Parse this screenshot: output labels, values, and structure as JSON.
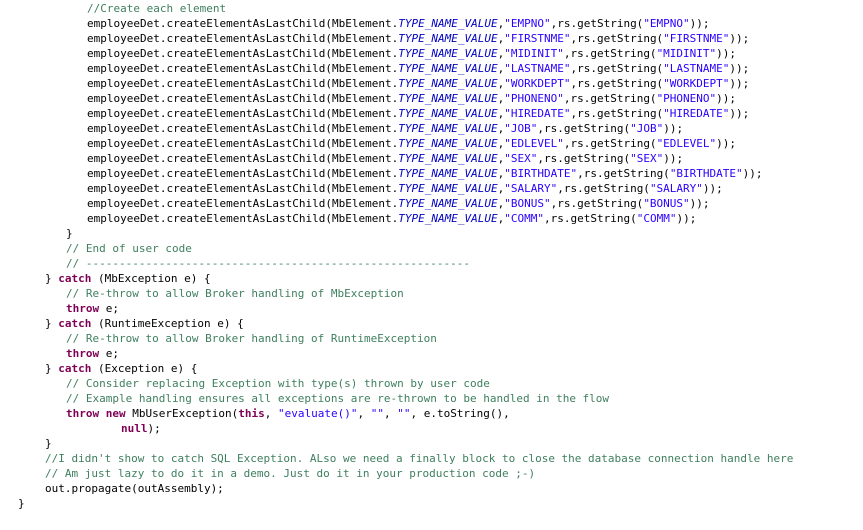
{
  "editor": {
    "lines": [
      {
        "indent": 12,
        "tokens": [
          {
            "t": "comment",
            "v": "//Create each element"
          }
        ]
      },
      {
        "indent": 12,
        "tokens": [
          {
            "t": "plain",
            "v": "employeeDet.createElementAsLastChild(MbElement."
          },
          {
            "t": "field",
            "v": "TYPE_NAME_VALUE"
          },
          {
            "t": "plain",
            "v": ","
          },
          {
            "t": "string",
            "v": "\"EMPNO\""
          },
          {
            "t": "plain",
            "v": ",rs.getString("
          },
          {
            "t": "string",
            "v": "\"EMPNO\""
          },
          {
            "t": "plain",
            "v": "));"
          }
        ]
      },
      {
        "indent": 12,
        "tokens": [
          {
            "t": "plain",
            "v": "employeeDet.createElementAsLastChild(MbElement."
          },
          {
            "t": "field",
            "v": "TYPE_NAME_VALUE"
          },
          {
            "t": "plain",
            "v": ","
          },
          {
            "t": "string",
            "v": "\"FIRSTNME\""
          },
          {
            "t": "plain",
            "v": ",rs.getString("
          },
          {
            "t": "string",
            "v": "\"FIRSTNME\""
          },
          {
            "t": "plain",
            "v": "));"
          }
        ]
      },
      {
        "indent": 12,
        "tokens": [
          {
            "t": "plain",
            "v": "employeeDet.createElementAsLastChild(MbElement."
          },
          {
            "t": "field",
            "v": "TYPE_NAME_VALUE"
          },
          {
            "t": "plain",
            "v": ","
          },
          {
            "t": "string",
            "v": "\"MIDINIT\""
          },
          {
            "t": "plain",
            "v": ",rs.getString("
          },
          {
            "t": "string",
            "v": "\"MIDINIT\""
          },
          {
            "t": "plain",
            "v": "));"
          }
        ]
      },
      {
        "indent": 12,
        "tokens": [
          {
            "t": "plain",
            "v": "employeeDet.createElementAsLastChild(MbElement."
          },
          {
            "t": "field",
            "v": "TYPE_NAME_VALUE"
          },
          {
            "t": "plain",
            "v": ","
          },
          {
            "t": "string",
            "v": "\"LASTNAME\""
          },
          {
            "t": "plain",
            "v": ",rs.getString("
          },
          {
            "t": "string",
            "v": "\"LASTNAME\""
          },
          {
            "t": "plain",
            "v": "));"
          }
        ]
      },
      {
        "indent": 12,
        "tokens": [
          {
            "t": "plain",
            "v": "employeeDet.createElementAsLastChild(MbElement."
          },
          {
            "t": "field",
            "v": "TYPE_NAME_VALUE"
          },
          {
            "t": "plain",
            "v": ","
          },
          {
            "t": "string",
            "v": "\"WORKDEPT\""
          },
          {
            "t": "plain",
            "v": ",rs.getString("
          },
          {
            "t": "string",
            "v": "\"WORKDEPT\""
          },
          {
            "t": "plain",
            "v": "));"
          }
        ]
      },
      {
        "indent": 12,
        "tokens": [
          {
            "t": "plain",
            "v": "employeeDet.createElementAsLastChild(MbElement."
          },
          {
            "t": "field",
            "v": "TYPE_NAME_VALUE"
          },
          {
            "t": "plain",
            "v": ","
          },
          {
            "t": "string",
            "v": "\"PHONENO\""
          },
          {
            "t": "plain",
            "v": ",rs.getString("
          },
          {
            "t": "string",
            "v": "\"PHONENO\""
          },
          {
            "t": "plain",
            "v": "));"
          }
        ]
      },
      {
        "indent": 12,
        "tokens": [
          {
            "t": "plain",
            "v": "employeeDet.createElementAsLastChild(MbElement."
          },
          {
            "t": "field",
            "v": "TYPE_NAME_VALUE"
          },
          {
            "t": "plain",
            "v": ","
          },
          {
            "t": "string",
            "v": "\"HIREDATE\""
          },
          {
            "t": "plain",
            "v": ",rs.getString("
          },
          {
            "t": "string",
            "v": "\"HIREDATE\""
          },
          {
            "t": "plain",
            "v": "));"
          }
        ]
      },
      {
        "indent": 12,
        "tokens": [
          {
            "t": "plain",
            "v": "employeeDet.createElementAsLastChild(MbElement."
          },
          {
            "t": "field",
            "v": "TYPE_NAME_VALUE"
          },
          {
            "t": "plain",
            "v": ","
          },
          {
            "t": "string",
            "v": "\"JOB\""
          },
          {
            "t": "plain",
            "v": ",rs.getString("
          },
          {
            "t": "string",
            "v": "\"JOB\""
          },
          {
            "t": "plain",
            "v": "));"
          }
        ]
      },
      {
        "indent": 12,
        "tokens": [
          {
            "t": "plain",
            "v": "employeeDet.createElementAsLastChild(MbElement."
          },
          {
            "t": "field",
            "v": "TYPE_NAME_VALUE"
          },
          {
            "t": "plain",
            "v": ","
          },
          {
            "t": "string",
            "v": "\"EDLEVEL\""
          },
          {
            "t": "plain",
            "v": ",rs.getString("
          },
          {
            "t": "string",
            "v": "\"EDLEVEL\""
          },
          {
            "t": "plain",
            "v": "));"
          }
        ]
      },
      {
        "indent": 12,
        "tokens": [
          {
            "t": "plain",
            "v": "employeeDet.createElementAsLastChild(MbElement."
          },
          {
            "t": "field",
            "v": "TYPE_NAME_VALUE"
          },
          {
            "t": "plain",
            "v": ","
          },
          {
            "t": "string",
            "v": "\"SEX\""
          },
          {
            "t": "plain",
            "v": ",rs.getString("
          },
          {
            "t": "string",
            "v": "\"SEX\""
          },
          {
            "t": "plain",
            "v": "));"
          }
        ]
      },
      {
        "indent": 12,
        "tokens": [
          {
            "t": "plain",
            "v": "employeeDet.createElementAsLastChild(MbElement."
          },
          {
            "t": "field",
            "v": "TYPE_NAME_VALUE"
          },
          {
            "t": "plain",
            "v": ","
          },
          {
            "t": "string",
            "v": "\"BIRTHDATE\""
          },
          {
            "t": "plain",
            "v": ",rs.getString("
          },
          {
            "t": "string",
            "v": "\"BIRTHDATE\""
          },
          {
            "t": "plain",
            "v": "));"
          }
        ]
      },
      {
        "indent": 12,
        "tokens": [
          {
            "t": "plain",
            "v": "employeeDet.createElementAsLastChild(MbElement."
          },
          {
            "t": "field",
            "v": "TYPE_NAME_VALUE"
          },
          {
            "t": "plain",
            "v": ","
          },
          {
            "t": "string",
            "v": "\"SALARY\""
          },
          {
            "t": "plain",
            "v": ",rs.getString("
          },
          {
            "t": "string",
            "v": "\"SALARY\""
          },
          {
            "t": "plain",
            "v": "));"
          }
        ]
      },
      {
        "indent": 12,
        "tokens": [
          {
            "t": "plain",
            "v": "employeeDet.createElementAsLastChild(MbElement."
          },
          {
            "t": "field",
            "v": "TYPE_NAME_VALUE"
          },
          {
            "t": "plain",
            "v": ","
          },
          {
            "t": "string",
            "v": "\"BONUS\""
          },
          {
            "t": "plain",
            "v": ",rs.getString("
          },
          {
            "t": "string",
            "v": "\"BONUS\""
          },
          {
            "t": "plain",
            "v": "));"
          }
        ]
      },
      {
        "indent": 12,
        "tokens": [
          {
            "t": "plain",
            "v": "employeeDet.createElementAsLastChild(MbElement."
          },
          {
            "t": "field",
            "v": "TYPE_NAME_VALUE"
          },
          {
            "t": "plain",
            "v": ","
          },
          {
            "t": "string",
            "v": "\"COMM\""
          },
          {
            "t": "plain",
            "v": ",rs.getString("
          },
          {
            "t": "string",
            "v": "\"COMM\""
          },
          {
            "t": "plain",
            "v": "));"
          }
        ]
      },
      {
        "indent": 9,
        "tokens": [
          {
            "t": "plain",
            "v": "}"
          }
        ]
      },
      {
        "indent": 9,
        "tokens": [
          {
            "t": "comment",
            "v": "// End of user code"
          }
        ]
      },
      {
        "indent": 9,
        "tokens": [
          {
            "t": "comment",
            "v": "// ----------------------------------------------------------"
          }
        ]
      },
      {
        "indent": 6,
        "tokens": [
          {
            "t": "plain",
            "v": "} "
          },
          {
            "t": "keyword",
            "v": "catch"
          },
          {
            "t": "plain",
            "v": " (MbException e) {"
          }
        ]
      },
      {
        "indent": 9,
        "tokens": [
          {
            "t": "comment",
            "v": "// Re-throw to allow Broker handling of MbException"
          }
        ]
      },
      {
        "indent": 9,
        "tokens": [
          {
            "t": "keyword",
            "v": "throw"
          },
          {
            "t": "plain",
            "v": " e;"
          }
        ]
      },
      {
        "indent": 6,
        "tokens": [
          {
            "t": "plain",
            "v": "} "
          },
          {
            "t": "keyword",
            "v": "catch"
          },
          {
            "t": "plain",
            "v": " (RuntimeException e) {"
          }
        ]
      },
      {
        "indent": 9,
        "tokens": [
          {
            "t": "comment",
            "v": "// Re-throw to allow Broker handling of RuntimeException"
          }
        ]
      },
      {
        "indent": 9,
        "tokens": [
          {
            "t": "keyword",
            "v": "throw"
          },
          {
            "t": "plain",
            "v": " e;"
          }
        ]
      },
      {
        "indent": 6,
        "tokens": [
          {
            "t": "plain",
            "v": "} "
          },
          {
            "t": "keyword",
            "v": "catch"
          },
          {
            "t": "plain",
            "v": " (Exception e) {"
          }
        ]
      },
      {
        "indent": 9,
        "tokens": [
          {
            "t": "comment",
            "v": "// Consider replacing Exception with type(s) thrown by user code"
          }
        ]
      },
      {
        "indent": 9,
        "tokens": [
          {
            "t": "comment",
            "v": "// Example handling ensures all exceptions are re-thrown to be handled in the flow"
          }
        ]
      },
      {
        "indent": 9,
        "tokens": [
          {
            "t": "keyword",
            "v": "throw"
          },
          {
            "t": "plain",
            "v": " "
          },
          {
            "t": "keyword",
            "v": "new"
          },
          {
            "t": "plain",
            "v": " MbUserException("
          },
          {
            "t": "keyword",
            "v": "this"
          },
          {
            "t": "plain",
            "v": ", "
          },
          {
            "t": "string",
            "v": "\"evaluate()\""
          },
          {
            "t": "plain",
            "v": ", "
          },
          {
            "t": "string",
            "v": "\"\""
          },
          {
            "t": "plain",
            "v": ", "
          },
          {
            "t": "string",
            "v": "\"\""
          },
          {
            "t": "plain",
            "v": ", e.toString(),"
          }
        ]
      },
      {
        "indent": 17,
        "tokens": [
          {
            "t": "keyword",
            "v": "null"
          },
          {
            "t": "plain",
            "v": ");"
          }
        ]
      },
      {
        "indent": 6,
        "tokens": [
          {
            "t": "plain",
            "v": "}"
          }
        ]
      },
      {
        "indent": 6,
        "tokens": [
          {
            "t": "comment",
            "v": "//I didn't show to catch SQL Exception. ALso we need a finally block to close the database connection handle here"
          }
        ]
      },
      {
        "indent": 6,
        "tokens": [
          {
            "t": "comment",
            "v": "// Am just lazy to do it in a demo. Just do it in your production code ;-)"
          }
        ]
      },
      {
        "indent": 6,
        "tokens": [
          {
            "t": "plain",
            "v": "out.propagate(outAssembly);"
          }
        ]
      },
      {
        "indent": 2,
        "tokens": [
          {
            "t": "plain",
            "v": "}"
          }
        ]
      }
    ]
  }
}
